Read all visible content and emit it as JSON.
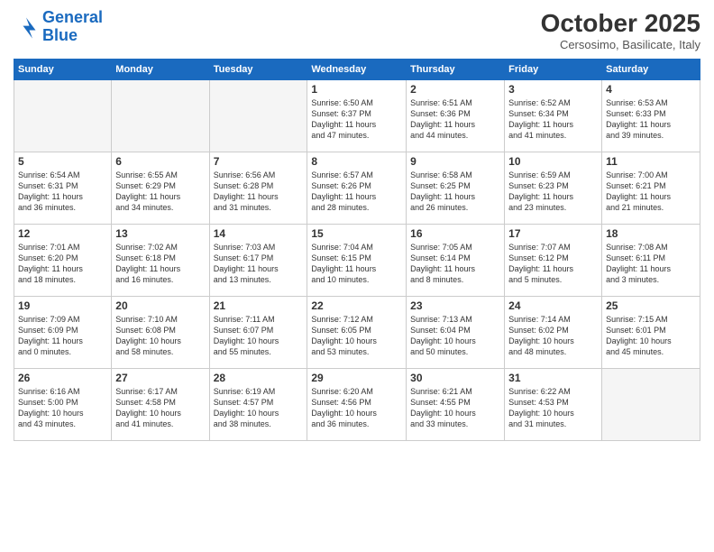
{
  "header": {
    "logo_line1": "General",
    "logo_line2": "Blue",
    "month_title": "October 2025",
    "location": "Cersosimo, Basilicate, Italy"
  },
  "weekdays": [
    "Sunday",
    "Monday",
    "Tuesday",
    "Wednesday",
    "Thursday",
    "Friday",
    "Saturday"
  ],
  "weeks": [
    [
      {
        "day": "",
        "empty": true
      },
      {
        "day": "",
        "empty": true
      },
      {
        "day": "",
        "empty": true
      },
      {
        "day": "1",
        "info": "Sunrise: 6:50 AM\nSunset: 6:37 PM\nDaylight: 11 hours\nand 47 minutes."
      },
      {
        "day": "2",
        "info": "Sunrise: 6:51 AM\nSunset: 6:36 PM\nDaylight: 11 hours\nand 44 minutes."
      },
      {
        "day": "3",
        "info": "Sunrise: 6:52 AM\nSunset: 6:34 PM\nDaylight: 11 hours\nand 41 minutes."
      },
      {
        "day": "4",
        "info": "Sunrise: 6:53 AM\nSunset: 6:33 PM\nDaylight: 11 hours\nand 39 minutes."
      }
    ],
    [
      {
        "day": "5",
        "info": "Sunrise: 6:54 AM\nSunset: 6:31 PM\nDaylight: 11 hours\nand 36 minutes."
      },
      {
        "day": "6",
        "info": "Sunrise: 6:55 AM\nSunset: 6:29 PM\nDaylight: 11 hours\nand 34 minutes."
      },
      {
        "day": "7",
        "info": "Sunrise: 6:56 AM\nSunset: 6:28 PM\nDaylight: 11 hours\nand 31 minutes."
      },
      {
        "day": "8",
        "info": "Sunrise: 6:57 AM\nSunset: 6:26 PM\nDaylight: 11 hours\nand 28 minutes."
      },
      {
        "day": "9",
        "info": "Sunrise: 6:58 AM\nSunset: 6:25 PM\nDaylight: 11 hours\nand 26 minutes."
      },
      {
        "day": "10",
        "info": "Sunrise: 6:59 AM\nSunset: 6:23 PM\nDaylight: 11 hours\nand 23 minutes."
      },
      {
        "day": "11",
        "info": "Sunrise: 7:00 AM\nSunset: 6:21 PM\nDaylight: 11 hours\nand 21 minutes."
      }
    ],
    [
      {
        "day": "12",
        "info": "Sunrise: 7:01 AM\nSunset: 6:20 PM\nDaylight: 11 hours\nand 18 minutes."
      },
      {
        "day": "13",
        "info": "Sunrise: 7:02 AM\nSunset: 6:18 PM\nDaylight: 11 hours\nand 16 minutes."
      },
      {
        "day": "14",
        "info": "Sunrise: 7:03 AM\nSunset: 6:17 PM\nDaylight: 11 hours\nand 13 minutes."
      },
      {
        "day": "15",
        "info": "Sunrise: 7:04 AM\nSunset: 6:15 PM\nDaylight: 11 hours\nand 10 minutes."
      },
      {
        "day": "16",
        "info": "Sunrise: 7:05 AM\nSunset: 6:14 PM\nDaylight: 11 hours\nand 8 minutes."
      },
      {
        "day": "17",
        "info": "Sunrise: 7:07 AM\nSunset: 6:12 PM\nDaylight: 11 hours\nand 5 minutes."
      },
      {
        "day": "18",
        "info": "Sunrise: 7:08 AM\nSunset: 6:11 PM\nDaylight: 11 hours\nand 3 minutes."
      }
    ],
    [
      {
        "day": "19",
        "info": "Sunrise: 7:09 AM\nSunset: 6:09 PM\nDaylight: 11 hours\nand 0 minutes."
      },
      {
        "day": "20",
        "info": "Sunrise: 7:10 AM\nSunset: 6:08 PM\nDaylight: 10 hours\nand 58 minutes."
      },
      {
        "day": "21",
        "info": "Sunrise: 7:11 AM\nSunset: 6:07 PM\nDaylight: 10 hours\nand 55 minutes."
      },
      {
        "day": "22",
        "info": "Sunrise: 7:12 AM\nSunset: 6:05 PM\nDaylight: 10 hours\nand 53 minutes."
      },
      {
        "day": "23",
        "info": "Sunrise: 7:13 AM\nSunset: 6:04 PM\nDaylight: 10 hours\nand 50 minutes."
      },
      {
        "day": "24",
        "info": "Sunrise: 7:14 AM\nSunset: 6:02 PM\nDaylight: 10 hours\nand 48 minutes."
      },
      {
        "day": "25",
        "info": "Sunrise: 7:15 AM\nSunset: 6:01 PM\nDaylight: 10 hours\nand 45 minutes."
      }
    ],
    [
      {
        "day": "26",
        "info": "Sunrise: 6:16 AM\nSunset: 5:00 PM\nDaylight: 10 hours\nand 43 minutes."
      },
      {
        "day": "27",
        "info": "Sunrise: 6:17 AM\nSunset: 4:58 PM\nDaylight: 10 hours\nand 41 minutes."
      },
      {
        "day": "28",
        "info": "Sunrise: 6:19 AM\nSunset: 4:57 PM\nDaylight: 10 hours\nand 38 minutes."
      },
      {
        "day": "29",
        "info": "Sunrise: 6:20 AM\nSunset: 4:56 PM\nDaylight: 10 hours\nand 36 minutes."
      },
      {
        "day": "30",
        "info": "Sunrise: 6:21 AM\nSunset: 4:55 PM\nDaylight: 10 hours\nand 33 minutes."
      },
      {
        "day": "31",
        "info": "Sunrise: 6:22 AM\nSunset: 4:53 PM\nDaylight: 10 hours\nand 31 minutes."
      },
      {
        "day": "",
        "empty": true
      }
    ]
  ]
}
